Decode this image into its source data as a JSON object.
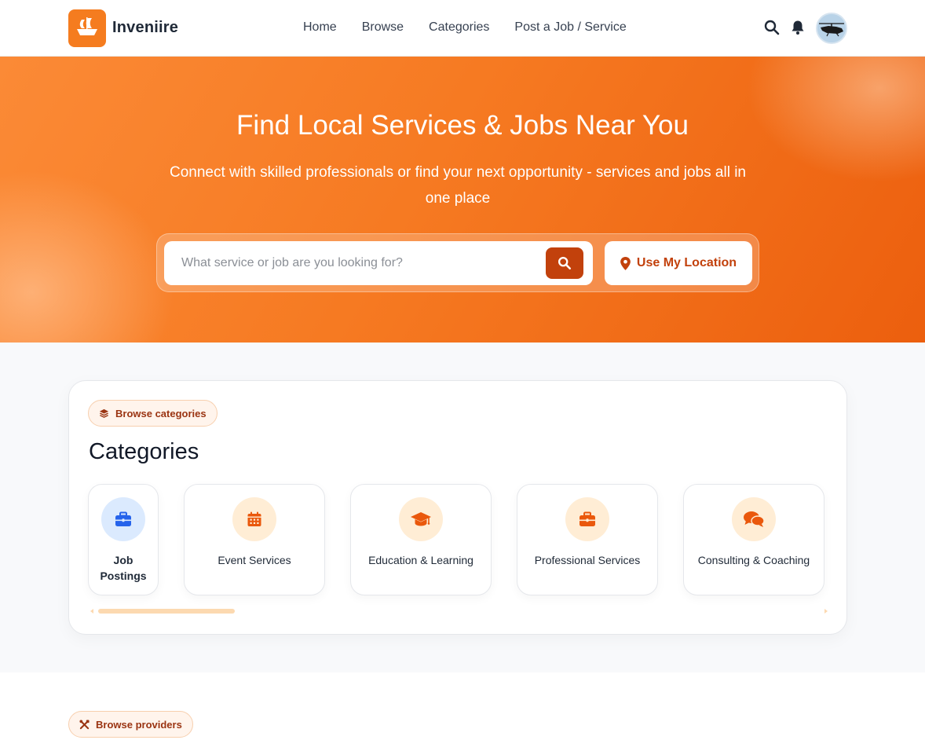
{
  "header": {
    "brand": "Inveniire",
    "nav": [
      "Home",
      "Browse",
      "Categories",
      "Post a Job / Service"
    ],
    "icons": [
      "search-icon",
      "bell-icon",
      "avatar"
    ]
  },
  "hero": {
    "title": "Find Local Services & Jobs Near You",
    "subtitle": "Connect with skilled professionals or find your next opportunity - services and jobs all in one place",
    "search_placeholder": "What service or job are you looking for?",
    "location_button": "Use My Location"
  },
  "categories": {
    "badge": "Browse categories",
    "heading": "Categories",
    "items": [
      {
        "label": "Job Postings",
        "icon": "briefcase-icon"
      },
      {
        "label": "Event Services",
        "icon": "calendar-icon"
      },
      {
        "label": "Education & Learning",
        "icon": "graduation-cap-icon"
      },
      {
        "label": "Professional Services",
        "icon": "briefcase-icon"
      },
      {
        "label": "Consulting & Coaching",
        "icon": "comments-icon"
      }
    ]
  },
  "providers": {
    "badge": "Browse providers"
  },
  "colors": {
    "brand": "#f57c1f",
    "accent_dark": "#c2410c",
    "job_postings_icon": "#2563eb"
  }
}
